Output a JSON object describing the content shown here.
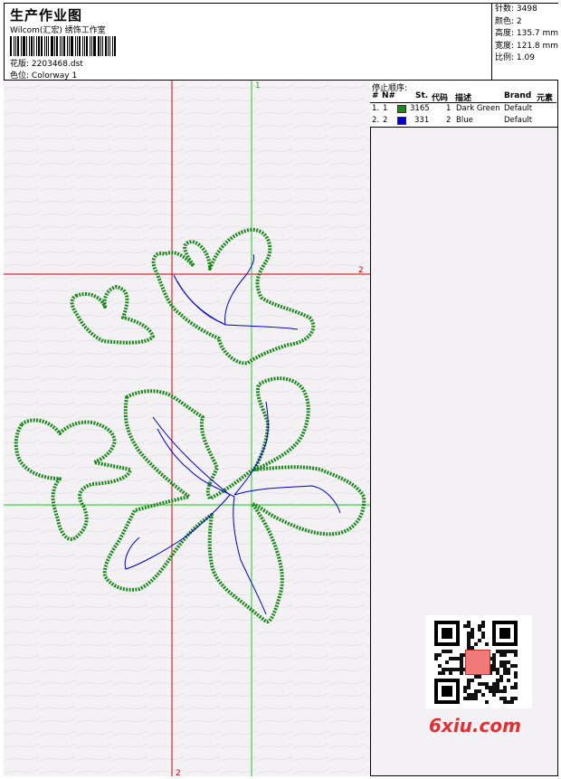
{
  "header": {
    "title": "生产作业图",
    "subtitle": "Wilcom(汇宏) 绣饰工作室",
    "design_label": "花版:",
    "design_value": "2203468.dst",
    "colorway_label": "色位:",
    "colorway_value": "Colorway 1"
  },
  "stats": {
    "stitches": "针数: 3498",
    "colors": "颜色: 2",
    "height": "高度: 135.7 mm",
    "width": "宽度: 121.8 mm",
    "ratio": "比例: 1.09"
  },
  "stop_sequence": {
    "title": "停止顺序:",
    "headers": [
      "#",
      "N#",
      "St.",
      "代码",
      "描述",
      "Brand",
      "元素"
    ],
    "rows": [
      {
        "num": "1.",
        "n": "1",
        "color": "#1a8a1a",
        "st": "3165",
        "code": "1",
        "desc": "Dark Green",
        "brand": "Default"
      },
      {
        "num": "2.",
        "n": "2",
        "color": "#0000cc",
        "st": "331",
        "code": "2",
        "desc": "Blue",
        "brand": "Default"
      }
    ]
  },
  "guides": {
    "green_label_top": "1",
    "red_label_right": "2",
    "red_label_bottom": "2"
  },
  "watermark": {
    "brand": "6xiu.com"
  },
  "colors": {
    "green_thread": "#1a8a1a",
    "blue_thread": "#0000cc",
    "red_guide": "#d40000",
    "green_guide": "#22cc22"
  }
}
